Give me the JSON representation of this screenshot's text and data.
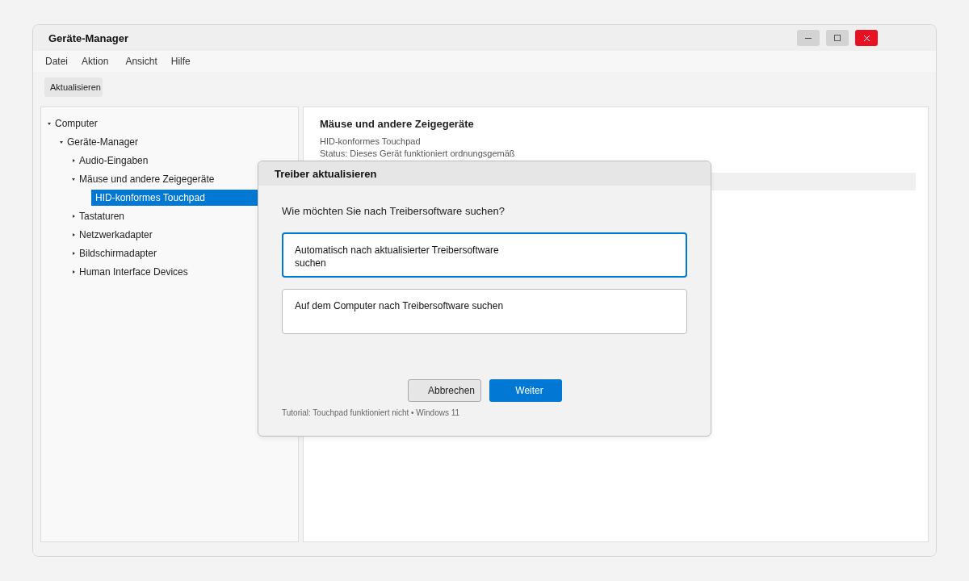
{
  "window": {
    "title": "Geräte-Manager",
    "controls": [
      {
        "kind": "minimize"
      },
      {
        "kind": "maximize"
      },
      {
        "kind": "close"
      }
    ]
  },
  "menu": [
    "Datei",
    "Aktion",
    "Ansicht",
    "Hilfe"
  ],
  "toolbar": {
    "buttons": [
      "Aktualisieren"
    ]
  },
  "tree": [
    {
      "label": "Computer",
      "expanded": true,
      "selected": false,
      "children": [
        {
          "label": "Geräte-Manager",
          "expanded": true,
          "selected": false,
          "children": [
            {
              "label": "Audio-Eingaben",
              "expanded": false,
              "selected": false
            },
            {
              "label": "Mäuse und andere Zeigegeräte",
              "expanded": true,
              "selected": false,
              "children": [
                {
                  "label": "HID-konformes Touchpad",
                  "selected": true
                }
              ]
            },
            {
              "label": "Tastaturen",
              "expanded": false,
              "selected": false
            },
            {
              "label": "Netzwerkadapter",
              "expanded": false,
              "selected": false
            },
            {
              "label": "Bildschirmadapter",
              "expanded": false,
              "selected": false
            },
            {
              "label": "Human Interface Devices",
              "expanded": false,
              "selected": false
            }
          ]
        }
      ]
    }
  ],
  "details": {
    "heading": "Mäuse und andere Zeigegeräte",
    "lines": [
      "HID-konformes Touchpad",
      "Status: Dieses Gerät funktioniert ordnungsgemäß"
    ]
  },
  "dialog": {
    "title": "Treiber aktualisieren",
    "question": "Wie möchten Sie nach Treibersoftware suchen?",
    "options": [
      {
        "label": "Automatisch nach aktualisierter Treibersoftware suchen",
        "selected": true
      },
      {
        "label": "Auf dem Computer nach Treibersoftware suchen",
        "selected": false
      }
    ],
    "buttons": [
      {
        "label": "Abbrechen",
        "kind": "secondary"
      },
      {
        "label": "Weiter",
        "kind": "primary"
      }
    ],
    "footer": "Tutorial: Touchpad funktioniert nicht • Windows 11"
  }
}
